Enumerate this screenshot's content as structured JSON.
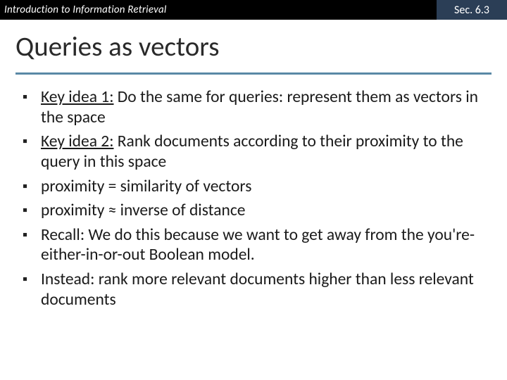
{
  "header": {
    "course": "Introduction to Information Retrieval",
    "section": "Sec. 6.3"
  },
  "title": "Queries as vectors",
  "bullets": [
    {
      "lead": "Key idea 1:",
      "rest": " Do the same for queries: represent them as vectors in the space"
    },
    {
      "lead": "Key idea 2:",
      "rest": " Rank documents according to their proximity to the query in this space"
    },
    {
      "lead": "",
      "rest": "proximity = similarity of vectors"
    },
    {
      "lead": "",
      "rest": "proximity ≈ inverse of distance"
    },
    {
      "lead": "",
      "rest": "Recall: We do this because we want to get away from the you're-either-in-or-out Boolean model."
    },
    {
      "lead": "",
      "rest": "Instead: rank more relevant documents higher than less relevant documents"
    }
  ]
}
